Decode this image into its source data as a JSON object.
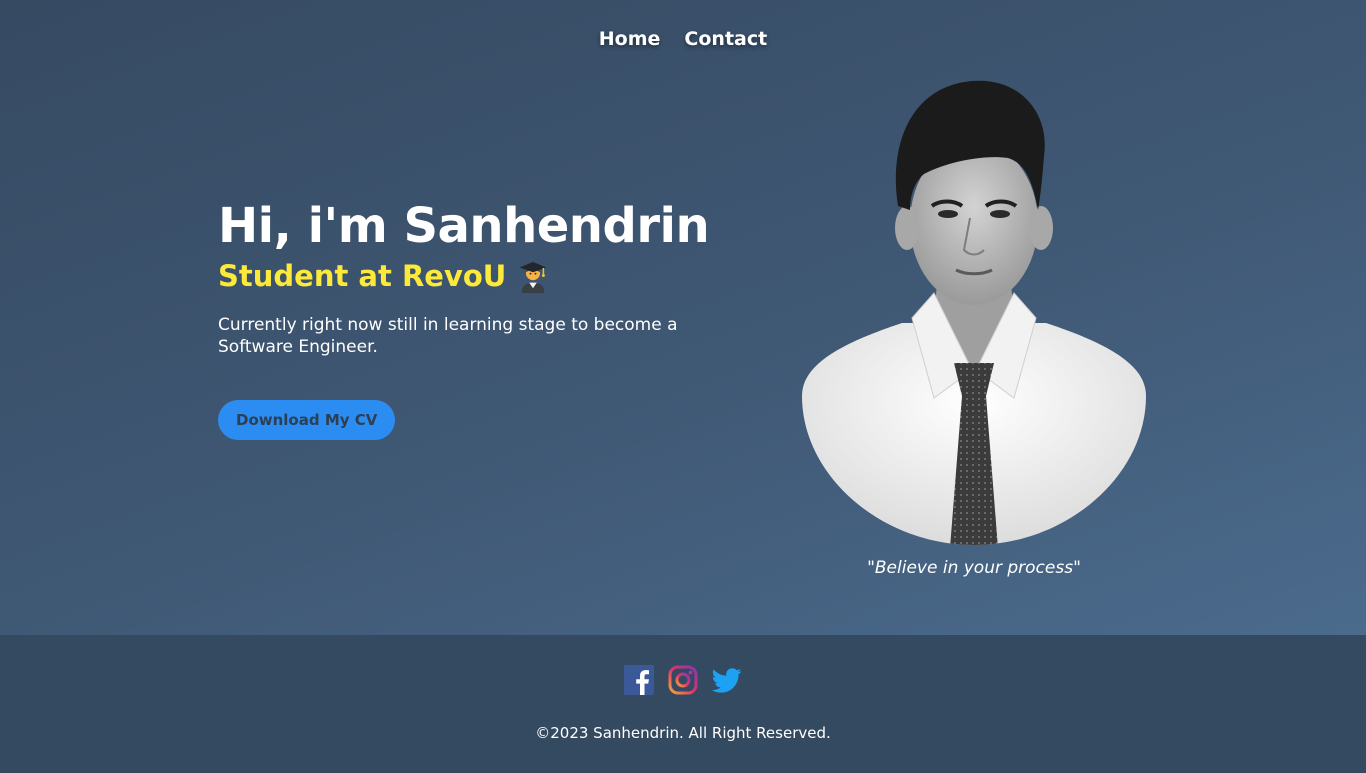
{
  "nav": {
    "items": [
      {
        "label": "Home"
      },
      {
        "label": "Contact"
      }
    ]
  },
  "hero": {
    "heading": "Hi, i'm Sanhendrin",
    "subtitle": "Student at RevoU",
    "subtitle_icon": "graduate-student-emoji",
    "description": "Currently right now still in learning stage to become a Software Engineer.",
    "cv_button_label": "Download My CV"
  },
  "portrait": {
    "image": "profile-photo",
    "quote": "\"Believe in your process\""
  },
  "footer": {
    "socials": [
      {
        "name": "facebook-icon"
      },
      {
        "name": "instagram-icon"
      },
      {
        "name": "twitter-icon"
      }
    ],
    "copyright": "©2023 Sanhendrin. All Right Reserved."
  },
  "colors": {
    "background_top": "#364a62",
    "background_bottom": "#4b6b8d",
    "footer": "#344a60",
    "accent_yellow": "#fde93a",
    "button_blue": "#2b8df2"
  }
}
